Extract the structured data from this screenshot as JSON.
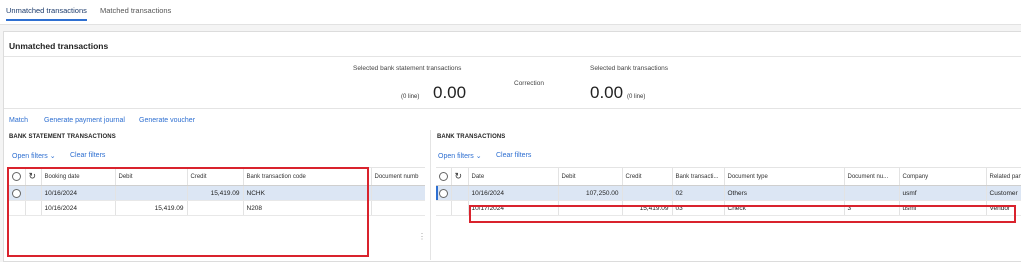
{
  "tabs": [
    "Unmatched transactions",
    "Matched transactions"
  ],
  "page_title": "Unmatched transactions",
  "summary": {
    "left_label": "Selected bank statement transactions",
    "left_value": "0.00",
    "left_unit": "(0 line)",
    "middle_label": "Correction",
    "right_label": "Selected bank transactions",
    "right_value": "0.00",
    "right_unit": "(0 line)"
  },
  "actions": [
    "Match",
    "Generate payment journal",
    "Generate voucher"
  ],
  "bank_statement": {
    "title": "BANK STATEMENT TRANSACTIONS",
    "open_filters": "Open filters",
    "clear_filters": "Clear filters",
    "columns": [
      "Booking date",
      "Debit",
      "Credit",
      "Bank transaction code",
      "Document numb"
    ],
    "rows": [
      {
        "date": "10/16/2024",
        "debit": "",
        "credit": "15,419.09",
        "code": "NCHK",
        "doc": ""
      },
      {
        "date": "10/16/2024",
        "debit": "15,419.09",
        "credit": "",
        "code": "N208",
        "doc": ""
      }
    ]
  },
  "bank": {
    "title": "BANK TRANSACTIONS",
    "open_filters": "Open filters",
    "clear_filters": "Clear filters",
    "columns": [
      "Date",
      "Debit",
      "Credit",
      "Bank transacti...",
      "Document type",
      "Document nu...",
      "Company",
      "Related part"
    ],
    "rows": [
      {
        "date": "10/16/2024",
        "debit": "107,250.00",
        "credit": "",
        "code": "02",
        "type": "Others",
        "doc": "",
        "company": "usmf",
        "related": "Customer"
      },
      {
        "date": "10/17/2024",
        "debit": "",
        "credit": "15,419.09",
        "code": "03",
        "type": "Check",
        "doc": "3",
        "company": "usmf",
        "related": "Vendor"
      }
    ]
  },
  "colors": {
    "accent": "#2e6fd1",
    "highlight": "#d9232d",
    "selected_row": "#dce6f4"
  },
  "icons": {
    "refresh": "refresh-icon",
    "chevron": "chevron-down-icon"
  }
}
